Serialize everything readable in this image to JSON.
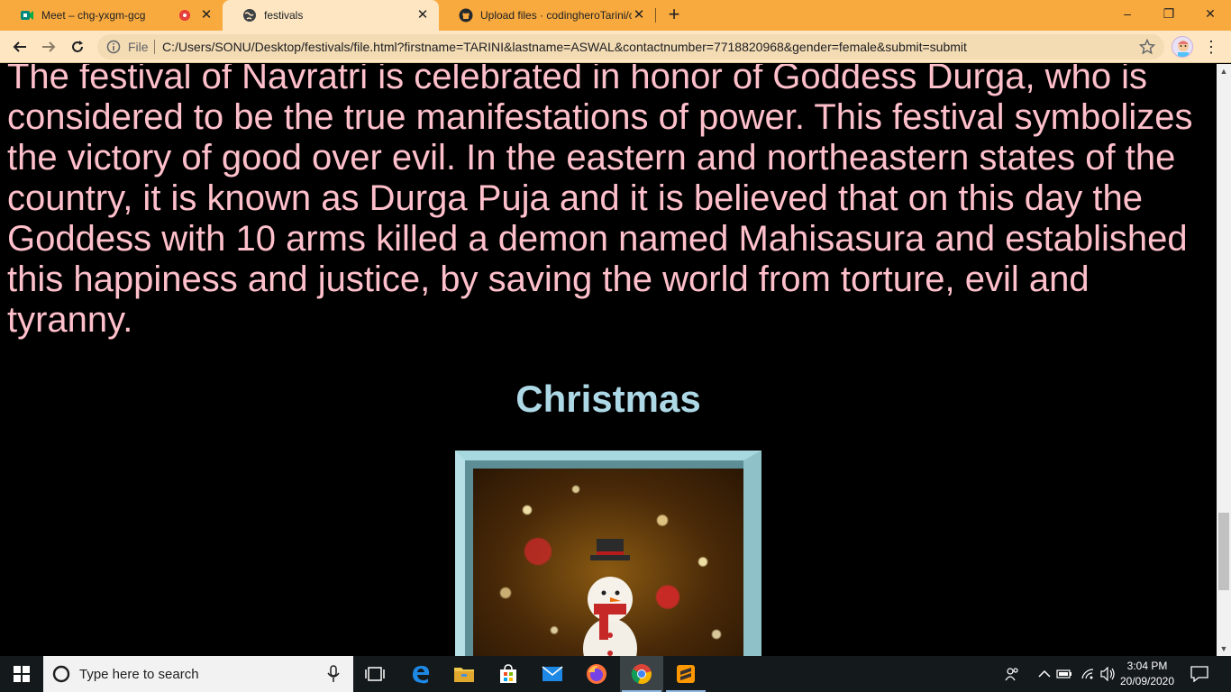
{
  "browser": {
    "tabs": [
      {
        "title": "Meet – chg-yxgm-gcg",
        "favicon": "meet-icon",
        "recording": true
      },
      {
        "title": "festivals",
        "favicon": "globe-icon",
        "active": true
      },
      {
        "title": "Upload files · codingheroTarini/cs",
        "favicon": "github-icon"
      }
    ],
    "close_glyph": "✕",
    "new_tab_glyph": "+",
    "window_controls": {
      "minimize": "–",
      "maximize": "❐",
      "close": "✕"
    },
    "omnibox": {
      "scheme_label": "File",
      "url": "C:/Users/SONU/Desktop/festivals/file.html?firstname=TARINI&lastname=ASWAL&contactnumber=7718820968&gender=female&submit=submit"
    },
    "menu_glyph": "⋮"
  },
  "page": {
    "paragraph": "The festival of Navratri is celebrated in honor of Goddess Durga, who is considered to be the true manifestations of power. This festival symbolizes the victory of good over evil. In the eastern and northeastern states of the country, it is known as Durga Puja and it is believed that on this day the Goddess with 10 arms killed a demon named Mahisasura and established this happiness and justice, by saving the world from torture, evil and tyranny.",
    "heading": "Christmas",
    "image": "christmas-snowman-image",
    "text_color": "#ffc0cb",
    "heading_color": "#add8e6",
    "background": "#000000"
  },
  "taskbar": {
    "search_placeholder": "Type here to search",
    "time": "3:04 PM",
    "date": "20/09/2020",
    "pinned": [
      "task-view-icon",
      "edge-icon",
      "file-explorer-icon",
      "store-icon",
      "mail-icon",
      "firefox-icon",
      "chrome-icon",
      "sublime-text-icon"
    ]
  }
}
